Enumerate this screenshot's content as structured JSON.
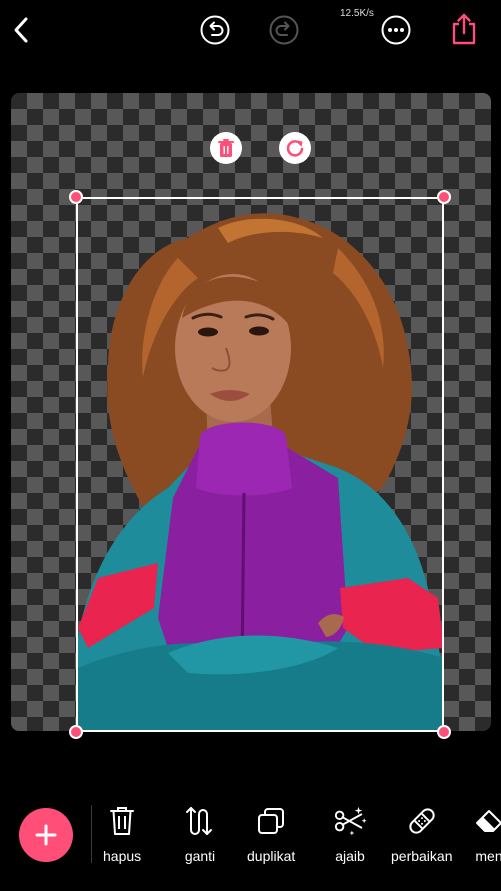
{
  "status": {
    "net_speed": "12.5K/s"
  },
  "toolbar": {
    "back_icon": "chevron-left-icon",
    "undo_icon": "undo-icon",
    "redo_icon": "redo-icon",
    "more_icon": "more-dots-icon",
    "share_icon": "share-icon",
    "accent_color": "#ff4f79"
  },
  "editor": {
    "canvas_background": "transparency-checkerboard",
    "floating_actions": [
      "trash-icon",
      "rotate-icon"
    ]
  },
  "bottom_toolbar": {
    "add_icon": "plus-icon",
    "tools": [
      {
        "label": "hapus",
        "icon": "trash-icon"
      },
      {
        "label": "ganti",
        "icon": "swap-arrows-icon"
      },
      {
        "label": "duplikat",
        "icon": "duplicate-icon"
      },
      {
        "label": "ajaib",
        "icon": "magic-scissors-icon"
      },
      {
        "label": "perbaikan",
        "icon": "bandage-icon"
      },
      {
        "label": "men",
        "icon": "eraser-icon"
      }
    ]
  }
}
